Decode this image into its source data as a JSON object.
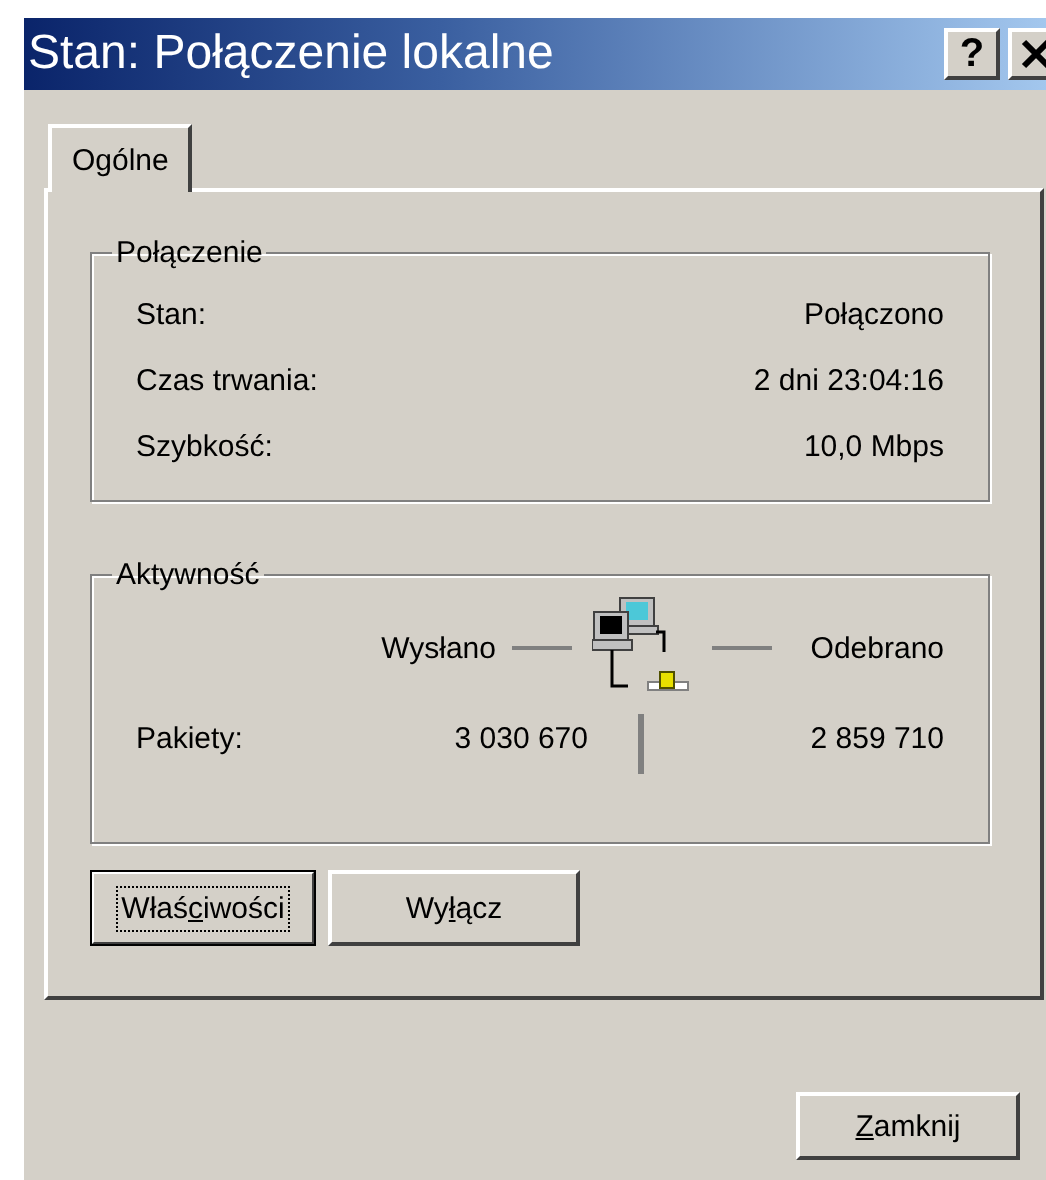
{
  "window": {
    "title": "Stan: Połączenie lokalne"
  },
  "title_buttons": [
    {
      "kind": "help",
      "label": "?"
    },
    {
      "kind": "close"
    }
  ],
  "tabs": [
    {
      "label": "Ogólne",
      "selected": true
    }
  ],
  "connection": {
    "title": "Połączenie",
    "rows": [
      {
        "label": "Stan:",
        "value": "Połączono"
      },
      {
        "label": "Czas trwania:",
        "value": "2 dni 23:04:16"
      },
      {
        "label": "Szybkość:",
        "value": "10,0 Mbps"
      }
    ]
  },
  "activity": {
    "title": "Aktywność",
    "sent_label": "Wysłano",
    "received_label": "Odebrano",
    "packets_label": "Pakiety:",
    "sent": "3 030 670",
    "received": "2 859 710"
  },
  "buttons": [
    {
      "label": "Właściwości",
      "focused": true
    },
    {
      "label": "Wyłącz",
      "focused": false
    }
  ],
  "close_button": {
    "label": "Zamknij",
    "focused": false
  }
}
